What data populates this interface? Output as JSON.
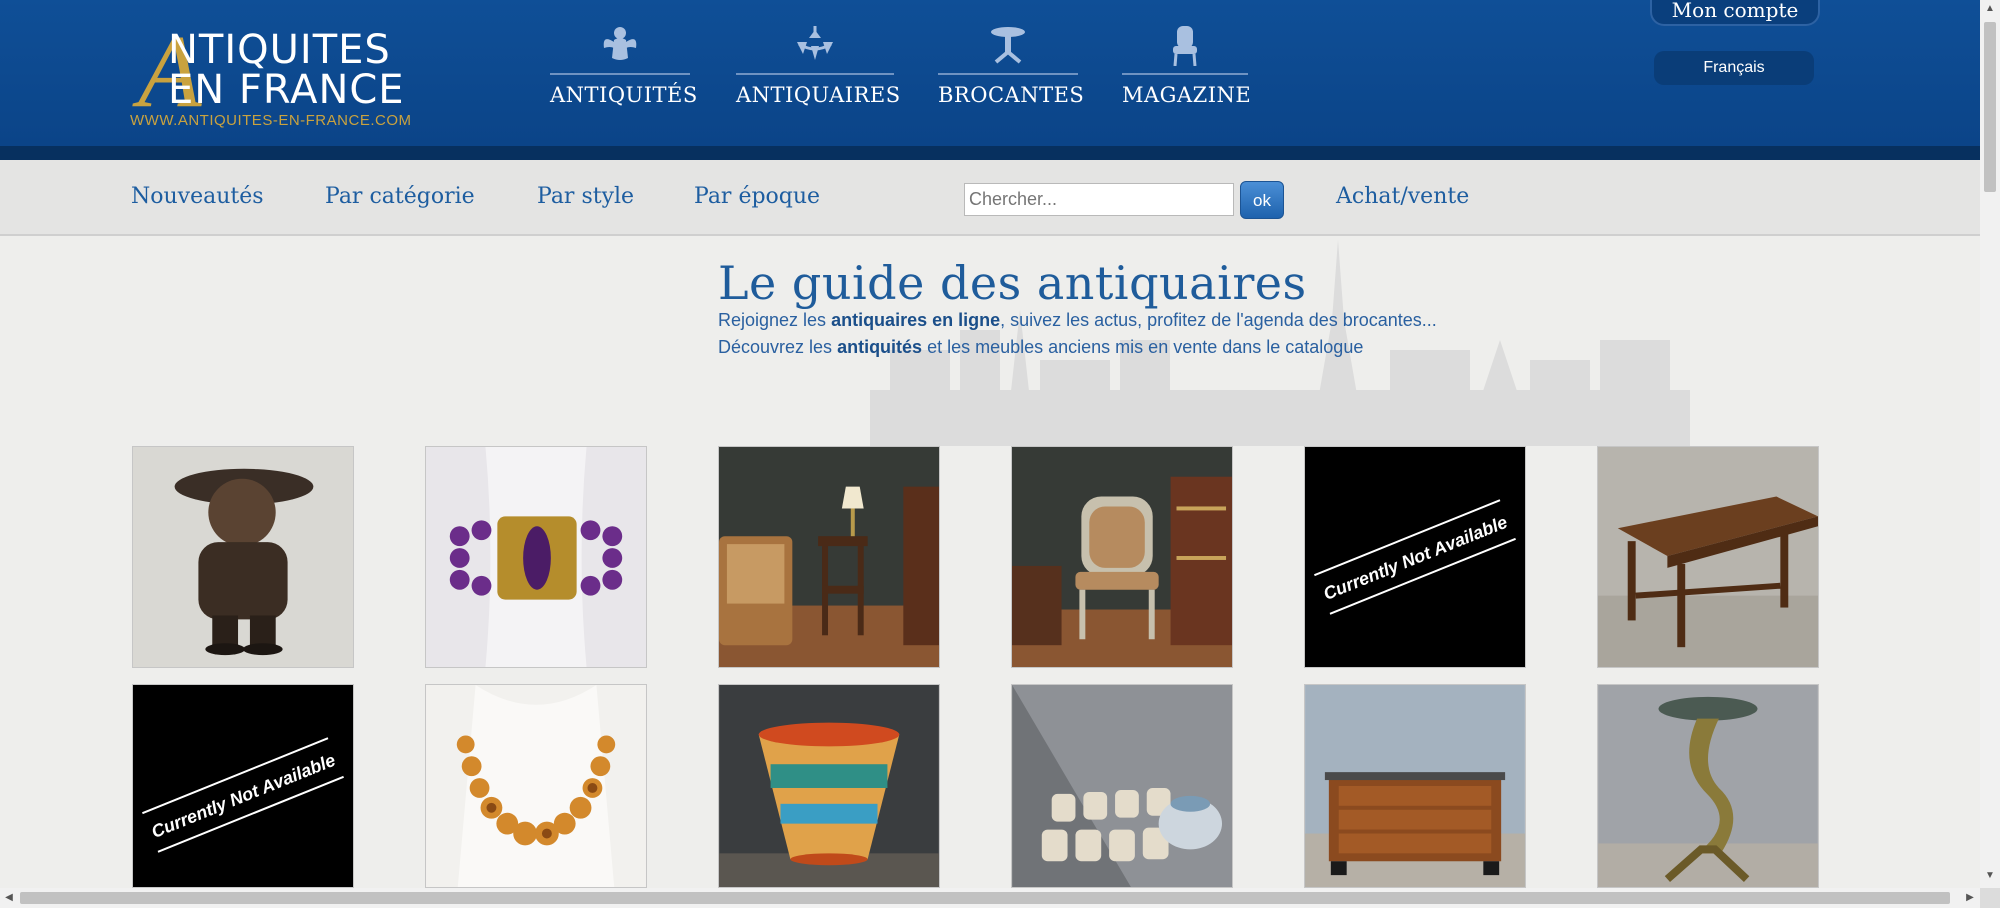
{
  "brand": {
    "line1": "NTIQUITES",
    "line2": "EN FRANCE",
    "initial": "A",
    "url": "WWW.ANTIQUITES-EN-FRANCE.COM"
  },
  "main_nav": [
    {
      "label": "ANTIQUITÉS",
      "icon": "cherub-icon"
    },
    {
      "label": "ANTIQUAIRES",
      "icon": "chandelier-icon"
    },
    {
      "label": "BROCANTES",
      "icon": "pedestal-table-icon"
    },
    {
      "label": "MAGAZINE",
      "icon": "armchair-icon"
    }
  ],
  "account": {
    "label": "Mon compte"
  },
  "language": {
    "selected": "Français"
  },
  "sub_nav": [
    {
      "label": "Nouveautés"
    },
    {
      "label": "Par catégorie"
    },
    {
      "label": "Par style"
    },
    {
      "label": "Par époque"
    },
    {
      "label": "Achat/vente"
    }
  ],
  "search": {
    "placeholder": "Chercher...",
    "button": "ok"
  },
  "hero": {
    "title": "Le guide des antiquaires",
    "line1_pre": "Rejoignez les ",
    "line1_bold": "antiquaires en ligne",
    "line1_post": ", suivez les actus, profitez de l'agenda des brocantes...",
    "line2_pre": "Découvrez les ",
    "line2_bold": "antiquités",
    "line2_post": " et les meubles anciens mis en vente dans le catalogue"
  },
  "unavailable_text": "Currently Not Available",
  "colors": {
    "header_blue": "#0d4a90",
    "link_blue": "#1d5da0",
    "gold": "#c9a23f"
  }
}
